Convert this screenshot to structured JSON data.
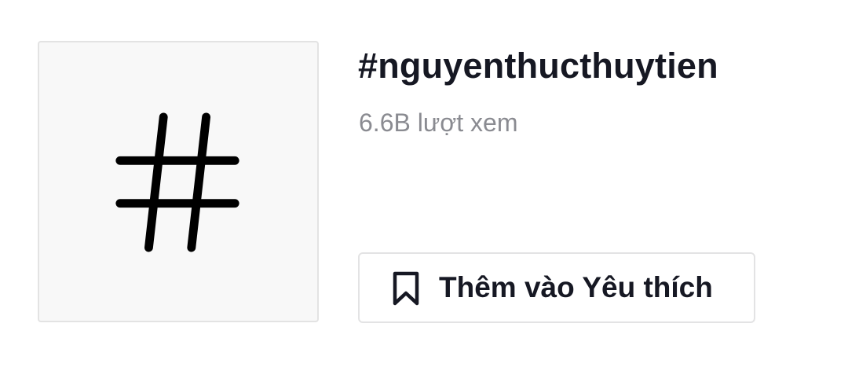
{
  "hashtag": {
    "title": "#nguyenthucthuytien",
    "views": "6.6B lượt xem",
    "cover_icon": "hash-icon",
    "favorite_button": {
      "label": "Thêm vào Yêu thích",
      "icon": "bookmark-icon"
    }
  },
  "colors": {
    "text_primary": "#161823",
    "text_secondary": "#8a8b91",
    "cover_bg": "#f8f8f8",
    "border": "#e3e3e3"
  }
}
